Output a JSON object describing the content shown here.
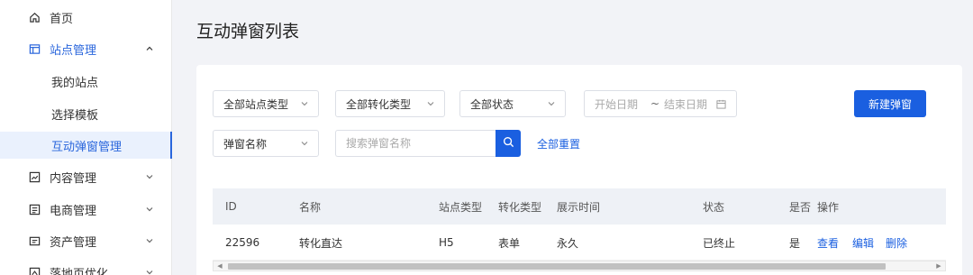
{
  "sidebar": {
    "items": [
      {
        "label": "首页",
        "icon": "home-icon"
      },
      {
        "label": "站点管理",
        "icon": "site-icon",
        "expanded": true
      },
      {
        "label": "我的站点"
      },
      {
        "label": "选择模板"
      },
      {
        "label": "互动弹窗管理",
        "active": true
      },
      {
        "label": "内容管理",
        "icon": "content-icon"
      },
      {
        "label": "电商管理",
        "icon": "ecommerce-icon"
      },
      {
        "label": "资产管理",
        "icon": "asset-icon"
      },
      {
        "label": "落地页优化",
        "icon": "landing-icon"
      }
    ]
  },
  "page": {
    "title": "互动弹窗列表"
  },
  "filters": {
    "site_type": "全部站点类型",
    "conversion_type": "全部转化类型",
    "status": "全部状态",
    "start_date": "开始日期",
    "date_sep": "~",
    "end_date": "结束日期",
    "create_button": "新建弹窗",
    "search_field": "弹窗名称",
    "search_placeholder": "搜索弹窗名称",
    "reset_link": "全部重置"
  },
  "table": {
    "columns": [
      "ID",
      "名称",
      "站点类型",
      "转化类型",
      "展示时间",
      "状态",
      "是否",
      "操作"
    ],
    "rows": [
      {
        "id": "22596",
        "name": "转化直达",
        "site_type": "H5",
        "conversion_type": "表单",
        "display_time": "永久",
        "status": "已终止",
        "flag": "是",
        "actions": [
          "查看",
          "编辑",
          "删除"
        ]
      }
    ]
  },
  "colors": {
    "accent": "#1a5fe0",
    "active_bg": "#eaf1fd"
  }
}
